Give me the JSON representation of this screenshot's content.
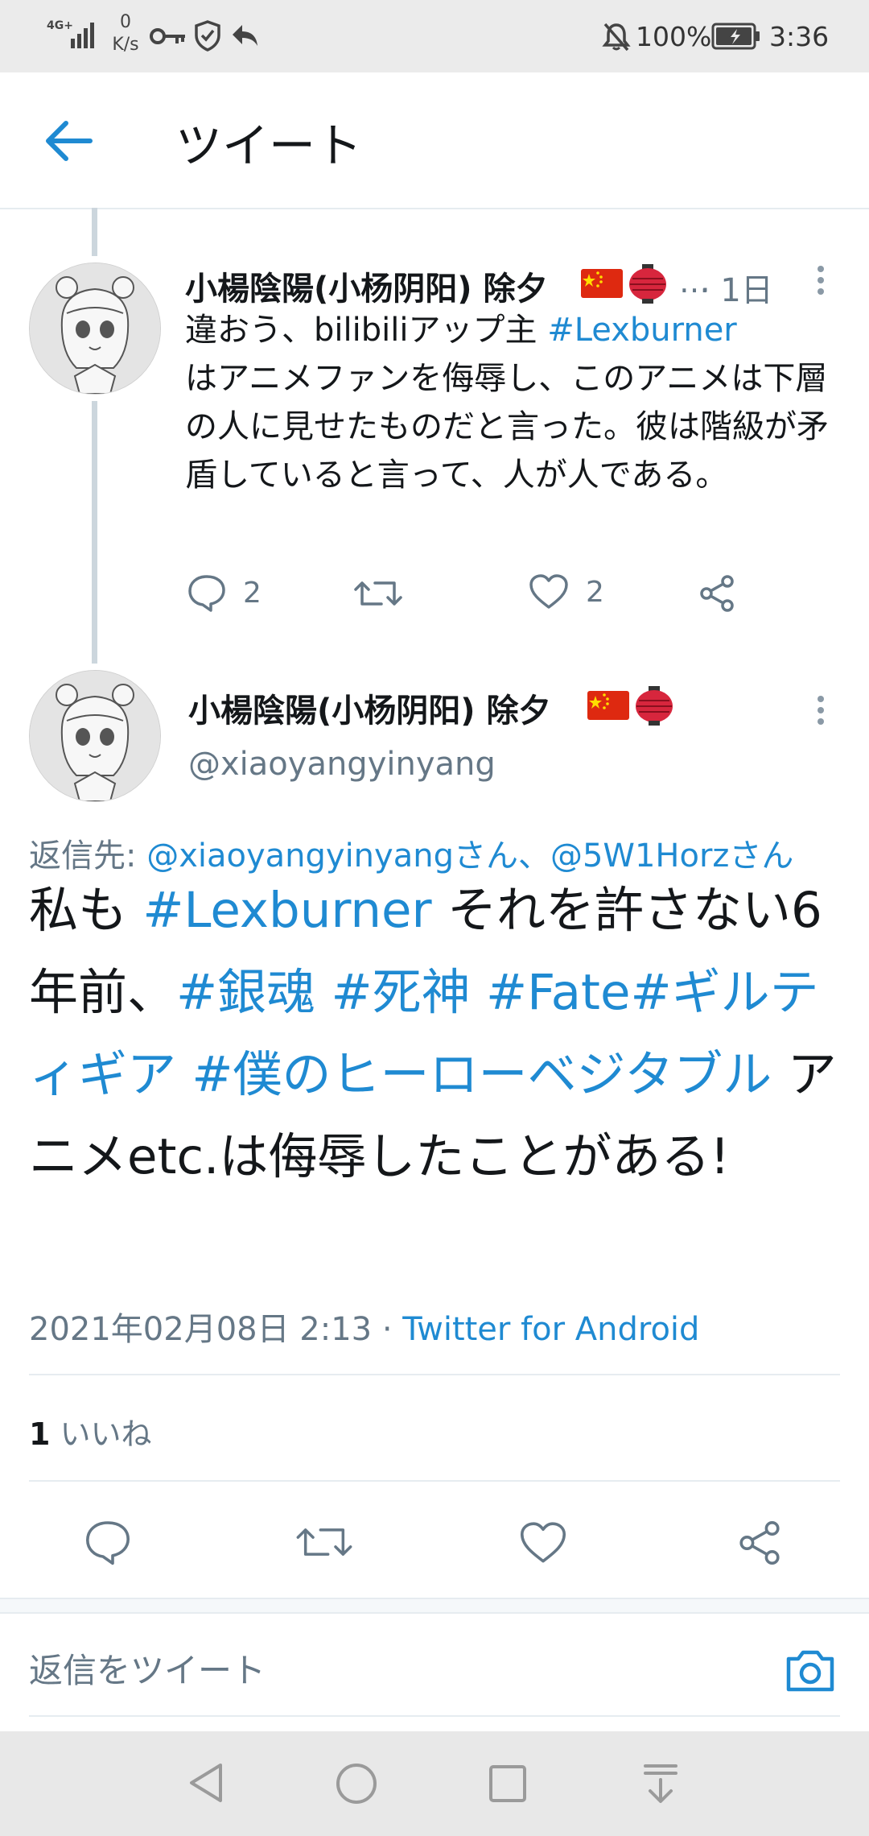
{
  "status_bar": {
    "network": "4G+",
    "speed_value": "0",
    "speed_unit": "K/s",
    "battery": "100%",
    "time": "3:36"
  },
  "header": {
    "title": "ツイート"
  },
  "parent_tweet": {
    "name": "小楊陰陽(小杨阴阳) 除夕",
    "emojis": [
      "flag-china",
      "red-lantern"
    ],
    "ellipsis": "…",
    "time": "· 1日",
    "text_part1": "違おう、bilibiliアップ主 ",
    "hashtag": "#Lexburner",
    "text_part2": "はアニメファンを侮辱し、このアニメは下層の人に見せたものだと言った。彼は階級が矛盾していると言って、人が人である。",
    "reply_count": "2",
    "like_count": "2"
  },
  "main_tweet": {
    "name": "小楊陰陽(小杨阴阳) 除夕",
    "handle": "@xiaoyangyinyang",
    "reply_prefix": "返信先: ",
    "reply_to": "@xiaoyangyinyangさん、@5W1Horzさん",
    "text_segments": [
      {
        "text": "私も ",
        "link": false
      },
      {
        "text": "#Lexburner",
        "link": true
      },
      {
        "text": " それを許さない",
        "link": false
      },
      {
        "text": "6年前、",
        "link": false
      },
      {
        "text": "#銀魂",
        "link": true
      },
      {
        "text": " ",
        "link": false
      },
      {
        "text": "#死神",
        "link": true
      },
      {
        "text": " ",
        "link": false
      },
      {
        "text": "#Fate",
        "link": true
      },
      {
        "text": "#ギルティギア",
        "link": true
      },
      {
        "text": " ",
        "link": false
      },
      {
        "text": "#僕のヒーローベジタブル",
        "link": true
      },
      {
        "text": " アニメetc.は侮辱したことがある!",
        "link": false
      }
    ],
    "timestamp": "2021年02月08日 2:13",
    "separator": " · ",
    "source": "Twitter for Android",
    "likes_count": "1",
    "likes_label": "いいね"
  },
  "reply_bar": {
    "placeholder": "返信をツイート"
  },
  "colors": {
    "accent": "#1f8ad2",
    "muted": "#657786",
    "text": "#14171a"
  }
}
